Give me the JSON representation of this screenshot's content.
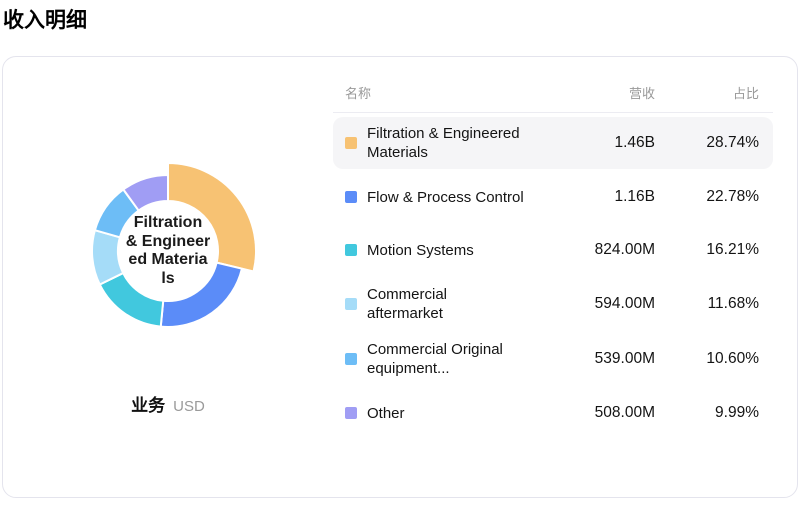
{
  "page": {
    "title": "收入明细"
  },
  "chart": {
    "center_label_lines": [
      "Filtration",
      "& Engineer",
      "ed Materia",
      "ls"
    ],
    "footer": {
      "dimension": "业务",
      "unit": "USD"
    }
  },
  "chart_data": {
    "type": "pie",
    "title": "收入明细",
    "unit": "USD",
    "donut": true,
    "legend_position": "right-table",
    "segments": [
      {
        "name": "Filtration & Engineered Materials",
        "revenue": "1.46B",
        "percent": 28.74,
        "color": "#f7c273",
        "selected": true
      },
      {
        "name": "Flow & Process Control",
        "revenue": "1.16B",
        "percent": 22.78,
        "color": "#5b8cf8",
        "selected": false
      },
      {
        "name": "Motion Systems",
        "revenue": "824.00M",
        "percent": 16.21,
        "color": "#41c8de",
        "selected": false
      },
      {
        "name": "Commercial aftermarket",
        "revenue": "594.00M",
        "percent": 11.68,
        "color": "#a5dcf8",
        "selected": false
      },
      {
        "name": "Commercial Original equipment",
        "revenue": "539.00M",
        "percent": 10.6,
        "color": "#6dbdf6",
        "selected": false
      },
      {
        "name": "Other",
        "revenue": "508.00M",
        "percent": 9.99,
        "color": "#a09df4",
        "selected": false
      }
    ]
  },
  "table": {
    "headers": {
      "name": "名称",
      "revenue": "营收",
      "percent": "占比"
    },
    "rows": [
      {
        "name": "Filtration & Engineered\nMaterials",
        "revenue": "1.46B",
        "percent": "28.74%",
        "color": "#f7c273",
        "highlighted": true
      },
      {
        "name": "Flow & Process Control",
        "revenue": "1.16B",
        "percent": "22.78%",
        "color": "#5b8cf8",
        "highlighted": false
      },
      {
        "name": "Motion Systems",
        "revenue": "824.00M",
        "percent": "16.21%",
        "color": "#41c8de",
        "highlighted": false
      },
      {
        "name": "Commercial\naftermarket",
        "revenue": "594.00M",
        "percent": "11.68%",
        "color": "#a5dcf8",
        "highlighted": false
      },
      {
        "name": "Commercial Original\nequipment...",
        "revenue": "539.00M",
        "percent": "10.60%",
        "color": "#6dbdf6",
        "highlighted": false
      },
      {
        "name": "Other",
        "revenue": "508.00M",
        "percent": "9.99%",
        "color": "#a09df4",
        "highlighted": false
      }
    ]
  }
}
